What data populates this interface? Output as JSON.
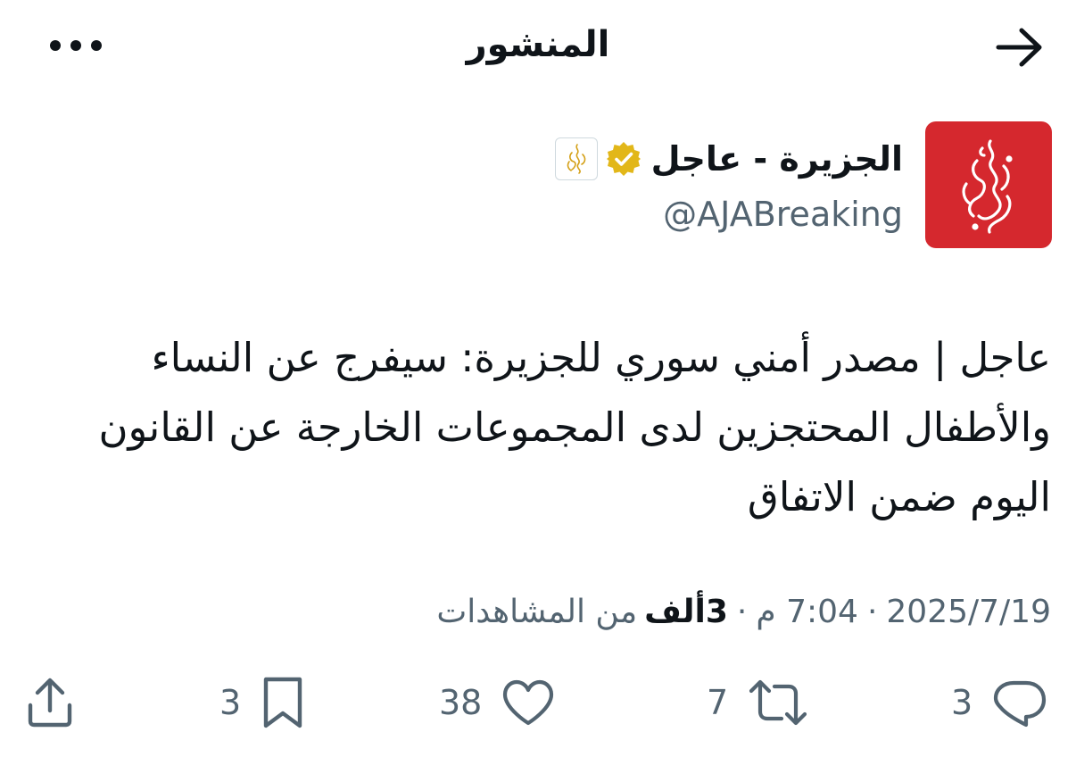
{
  "header": {
    "title": "المنشور",
    "back_icon": "arrow-right-icon",
    "more_icon": "more-horizontal-icon"
  },
  "author": {
    "name": "الجزيرة - عاجل",
    "handle": "@AJABreaking",
    "verified_color": "#e2b719",
    "avatar_bg": "#d5282e",
    "avatar_icon": "al-jazeera-logo",
    "affiliate_icon": "al-jazeera-affiliate-badge-icon"
  },
  "post": {
    "text": "عاجل | مصدر أمني سوري للجزيرة: سيفرج عن النساء والأطفال المحتجزين لدى المجموعات الخارجة عن القانون اليوم ضمن الاتفاق"
  },
  "meta": {
    "date": "2025/7/19",
    "time": "7:04 م",
    "views_count": "3ألف",
    "views_label": "من المشاهدات",
    "separator": "·"
  },
  "actions": {
    "reply_count": "3",
    "retweet_count": "7",
    "like_count": "38",
    "bookmark_count": "3",
    "icons": [
      "reply-icon",
      "retweet-icon",
      "like-icon",
      "bookmark-icon",
      "share-icon"
    ]
  }
}
